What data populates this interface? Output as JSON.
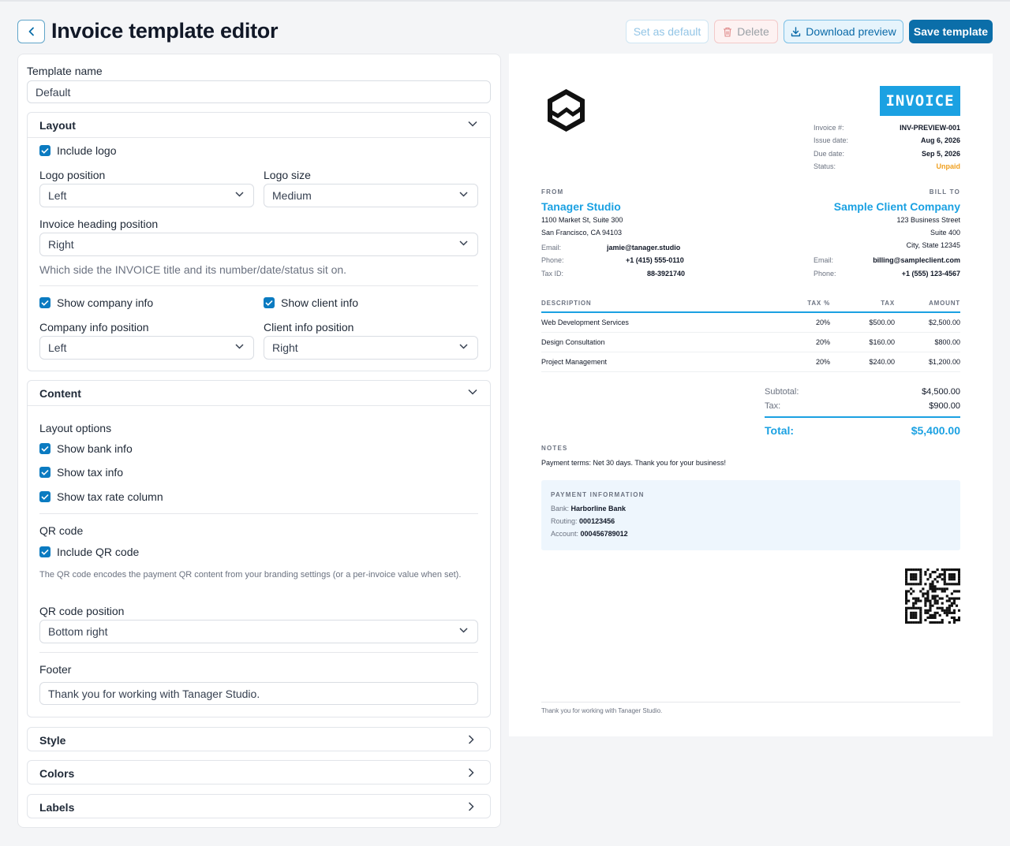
{
  "header": {
    "title": "Invoice template editor",
    "buttons": {
      "set_default": "Set as default",
      "delete": "Delete",
      "download": "Download preview",
      "save": "Save template"
    }
  },
  "form": {
    "template_name_label": "Template name",
    "template_name_value": "Default",
    "layout": {
      "title": "Layout",
      "include_logo": "Include logo",
      "logo_position_label": "Logo position",
      "logo_position_value": "Left",
      "logo_size_label": "Logo size",
      "logo_size_value": "Medium",
      "heading_position_label": "Invoice heading position",
      "heading_position_value": "Right",
      "heading_hint": "Which side the INVOICE title and its number/date/status sit on.",
      "show_company_info": "Show company info",
      "show_client_info": "Show client info",
      "company_position_label": "Company info position",
      "company_position_value": "Left",
      "client_position_label": "Client info position",
      "client_position_value": "Right"
    },
    "content": {
      "title": "Content",
      "layout_options_label": "Layout options",
      "show_bank_info": "Show bank info",
      "show_tax_info": "Show tax info",
      "show_tax_rate_column": "Show tax rate column",
      "qr_label": "QR code",
      "include_qr": "Include QR code",
      "qr_hint": "The QR code encodes the payment QR content from your branding settings (or a per-invoice value when set).",
      "qr_position_label": "QR code position",
      "qr_position_value": "Bottom right",
      "footer_label": "Footer",
      "footer_value": "Thank you for working with Tanager Studio."
    },
    "collapsed_sections": [
      "Style",
      "Colors",
      "Labels"
    ]
  },
  "preview": {
    "invoice_badge": "INVOICE",
    "meta": [
      {
        "k": "Invoice #:",
        "v": "INV-PREVIEW-001"
      },
      {
        "k": "Issue date:",
        "v": "Aug 6, 2026"
      },
      {
        "k": "Due date:",
        "v": "Sep 5, 2026"
      },
      {
        "k": "Status:",
        "v": "Unpaid"
      }
    ],
    "from": {
      "caption": "FROM",
      "name": "Tanager Studio",
      "address1": "1100 Market St, Suite 300",
      "address2": "San Francisco, CA 94103",
      "email_k": "Email:",
      "email_v": "jamie@tanager.studio",
      "phone_k": "Phone:",
      "phone_v": "+1 (415) 555-0110",
      "tax_k": "Tax ID:",
      "tax_v": "88-3921740"
    },
    "to": {
      "caption": "BILL TO",
      "name": "Sample Client Company",
      "address1": "123 Business Street",
      "address2": "Suite 400",
      "address3": "City, State 12345",
      "email_k": "Email:",
      "email_v": "billing@sampleclient.com",
      "phone_k": "Phone:",
      "phone_v": "+1 (555) 123-4567"
    },
    "table": {
      "headers": [
        "DESCRIPTION",
        "TAX %",
        "TAX",
        "AMOUNT"
      ],
      "rows": [
        [
          "Web Development Services",
          "20%",
          "$500.00",
          "$2,500.00"
        ],
        [
          "Design Consultation",
          "20%",
          "$160.00",
          "$800.00"
        ],
        [
          "Project Management",
          "20%",
          "$240.00",
          "$1,200.00"
        ]
      ]
    },
    "totals": {
      "subtotal_k": "Subtotal:",
      "subtotal_v": "$4,500.00",
      "tax_k": "Tax:",
      "tax_v": "$900.00",
      "total_k": "Total:",
      "total_v": "$5,400.00"
    },
    "notes": {
      "caption": "NOTES",
      "text": "Payment terms: Net 30 days. Thank you for your business!"
    },
    "payment": {
      "caption": "PAYMENT INFORMATION",
      "bank_k": "Bank:",
      "bank_v": "Harborline Bank",
      "routing_k": "Routing:",
      "routing_v": "000123456",
      "account_k": "Account:",
      "account_v": "000456789012"
    },
    "footer": "Thank you for working with Tanager Studio."
  },
  "colors": {
    "accent": "#1ba1e2",
    "primary_button": "#0b6ea9",
    "status_unpaid": "#f0a020"
  }
}
